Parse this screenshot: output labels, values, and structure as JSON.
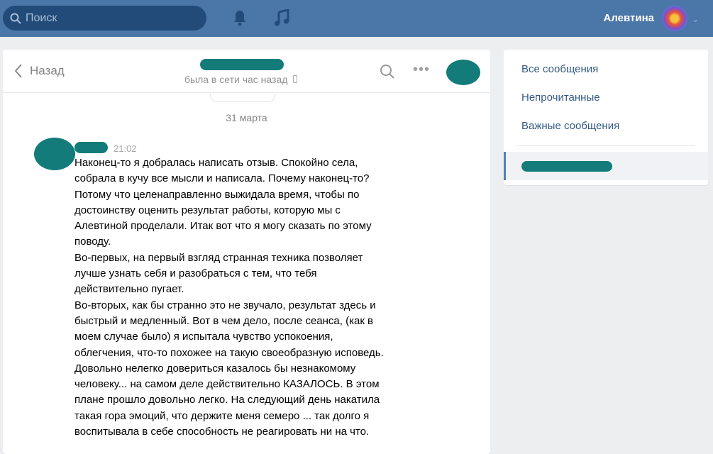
{
  "topbar": {
    "search_placeholder": "Поиск",
    "user_name": "Алевтина"
  },
  "chat": {
    "back_label": "Назад",
    "status": "была в сети час назад",
    "date": "31 марта",
    "message": {
      "time": "21:02",
      "lines": [
        "Наконец-то я добралась написать отзыв. Спокойно села,",
        "собрала в кучу все мысли и написала. Почему наконец-то?",
        "Потому что целенаправленно выжидала время, чтобы по",
        "достоинству оценить результат работы, которую мы с",
        "Алевтиной проделали. Итак вот что я могу сказать по этому",
        "поводу.",
        "Во-первых, на первый взгляд странная техника позволяет",
        "лучше узнать себя и разобраться с тем, что тебя",
        "действительно пугает.",
        "Во-вторых, как бы странно это не звучало, результат здесь и",
        "быстрый и медленный. Вот в чем дело, после сеанса, (как в",
        "моем случае было) я испытала чувство успокоения,",
        "облегчения, что-то похожее на такую своеобразную исповедь.",
        "Довольно нелегко довериться казалось бы незнакомому",
        "человеку... на самом деле действительно КАЗАЛОСЬ. В этом",
        "плане прошло довольно легко. На следующий день накатила",
        "такая гора эмоций, что держите меня семеро ... так долго я",
        "воспитывала в себе способность не реагировать ни на что."
      ]
    }
  },
  "sidebar": {
    "items": [
      "Все сообщения",
      "Непрочитанные",
      "Важные сообщения"
    ]
  }
}
